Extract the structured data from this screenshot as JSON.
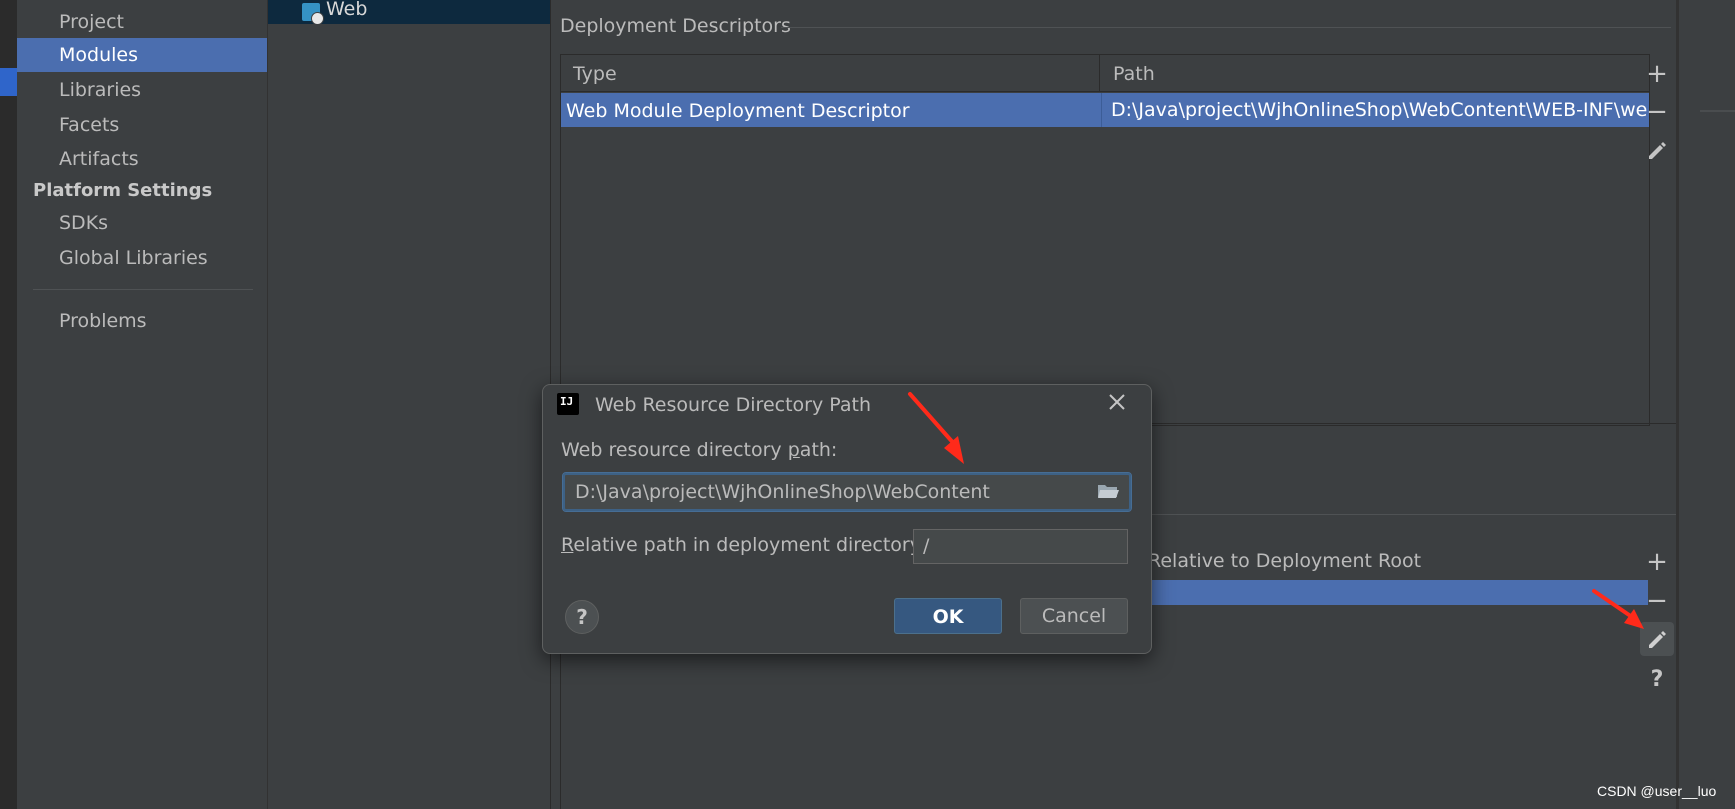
{
  "sidebar": {
    "items": [
      {
        "label": "Project"
      },
      {
        "label": "Modules"
      },
      {
        "label": "Libraries"
      },
      {
        "label": "Facets"
      },
      {
        "label": "Artifacts"
      }
    ],
    "platform_heading": "Platform Settings",
    "platform_items": [
      {
        "label": "SDKs"
      },
      {
        "label": "Global Libraries"
      }
    ],
    "problems": "Problems"
  },
  "tree": {
    "web_label": "Web"
  },
  "descriptors": {
    "section_title": "Deployment Descriptors",
    "columns": [
      "Type",
      "Path"
    ],
    "rows": [
      {
        "type": "Web Module Deployment Descriptor",
        "path": "D:\\Java\\project\\WjhOnlineShop\\WebContent\\WEB-INF\\web.xml"
      }
    ]
  },
  "resources": {
    "column_relative": "Relative to Deployment Root"
  },
  "dialog": {
    "title": "Web Resource Directory Path",
    "icon_text": "IJ",
    "path_label_pre": "Web resource directory ",
    "path_label_mnemonic": "p",
    "path_label_post": "ath:",
    "path_value": "D:\\Java\\project\\WjhOnlineShop\\WebContent",
    "rel_label_mnemonic": "R",
    "rel_label_post": "elative path in deployment directory:",
    "rel_value": "/",
    "help": "?",
    "ok": "OK",
    "cancel": "Cancel"
  },
  "toolbar": {
    "add": "+",
    "remove": "−",
    "help": "?"
  },
  "watermark": "CSDN @user__luo",
  "colors": {
    "selection": "#4b6eaf",
    "background": "#3c3f41",
    "arrow": "#ff2a1a"
  }
}
